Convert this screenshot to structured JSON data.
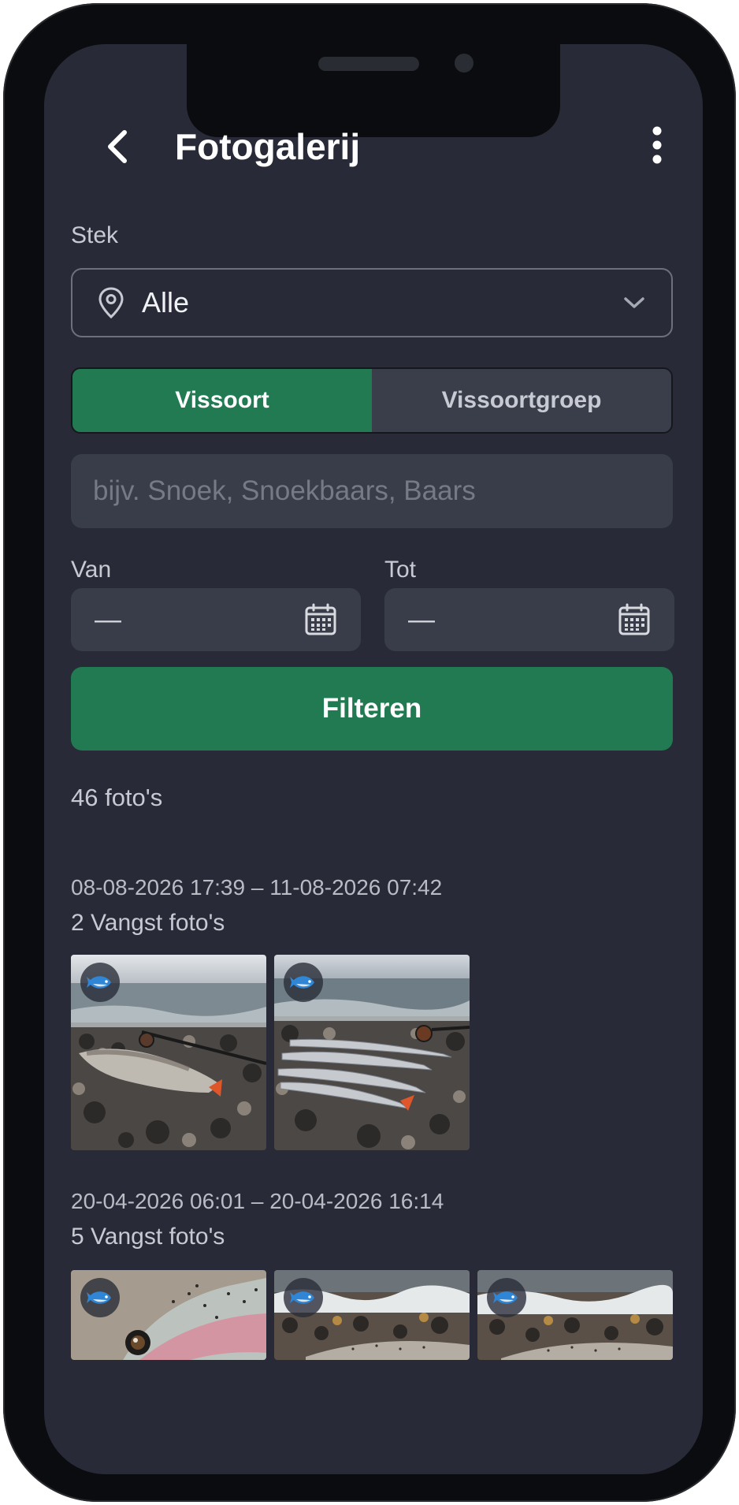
{
  "header": {
    "title": "Fotogalerij"
  },
  "filters": {
    "stek_label": "Stek",
    "stek_value": "Alle",
    "segments": [
      {
        "label": "Vissoort",
        "active": true
      },
      {
        "label": "Vissoortgroep",
        "active": false
      }
    ],
    "search_placeholder": "bijv. Snoek, Snoekbaars, Baars",
    "search_value": "",
    "from_label": "Van",
    "from_value": "—",
    "to_label": "Tot",
    "to_value": "—",
    "filter_button": "Filteren"
  },
  "results": {
    "count_text": "46 foto's",
    "groups": [
      {
        "range": "08-08-2026 17:39 – 11-08-2026 07:42",
        "count": "2 Vangst foto's"
      },
      {
        "range": "20-04-2026 06:01 – 20-04-2026 16:14",
        "count": "5 Vangst foto's"
      }
    ]
  },
  "colors": {
    "background": "#282b37",
    "accent_green": "#217a51",
    "field": "#393c49"
  },
  "icons": [
    "back-arrow-icon",
    "more-vertical-icon",
    "location-pin-icon",
    "chevron-down-icon",
    "calendar-icon",
    "fish-icon"
  ]
}
